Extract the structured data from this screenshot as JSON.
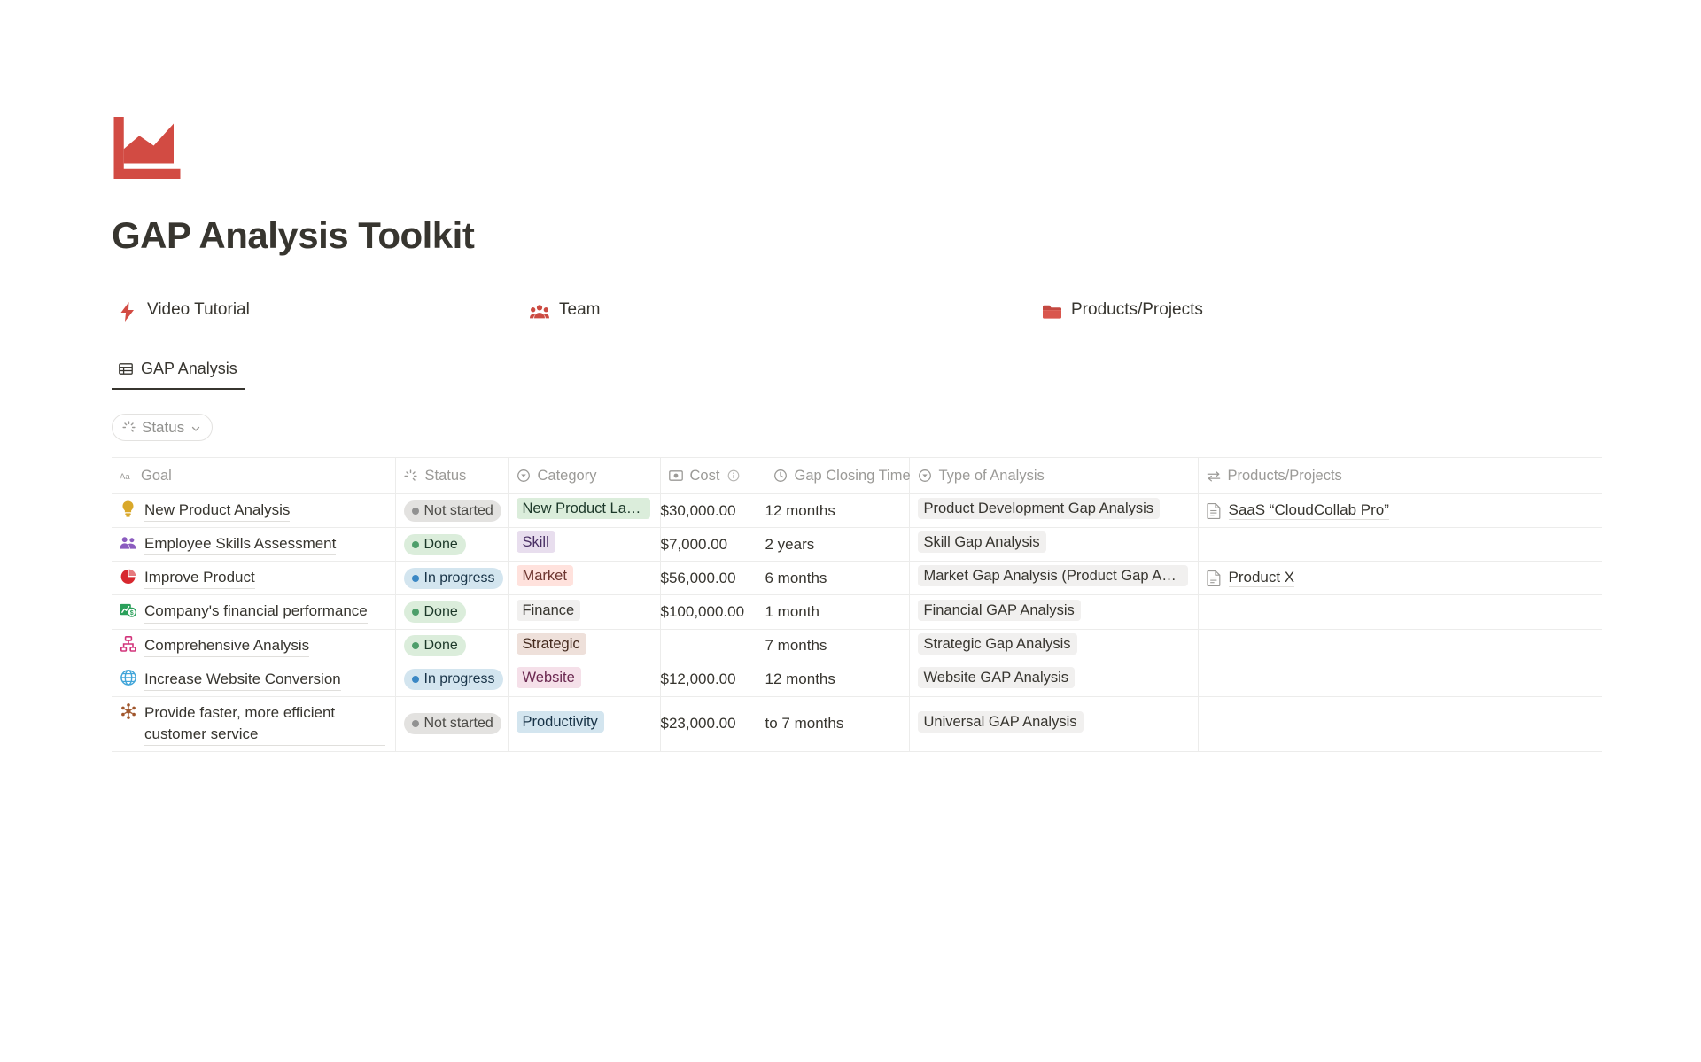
{
  "header": {
    "logo_icon": "area-chart-icon",
    "logo_color": "#d24b43",
    "title": "GAP Analysis Toolkit"
  },
  "nav_links": [
    {
      "label": "Video Tutorial",
      "icon": "lightning-bolt-icon",
      "color": "#d24b43"
    },
    {
      "label": "Team",
      "icon": "people-group-icon",
      "color": "#cc4b42"
    },
    {
      "label": "Products/Projects",
      "icon": "folder-icon",
      "color": "#d24b43"
    }
  ],
  "tabs": [
    {
      "label": "GAP Analysis",
      "icon": "table-grid-icon",
      "active": true
    }
  ],
  "filters": [
    {
      "label": "Status",
      "icon": "status-spinner-icon",
      "chevron": "chevron-down-icon"
    }
  ],
  "table": {
    "columns": [
      {
        "key": "goal",
        "label": "Goal",
        "icon": "title-aa-icon"
      },
      {
        "key": "status",
        "label": "Status",
        "icon": "status-spinner-icon"
      },
      {
        "key": "category",
        "label": "Category",
        "icon": "select-circle-icon"
      },
      {
        "key": "cost",
        "label": "Cost",
        "icon": "money-icon",
        "info_icon": "info-circle-icon"
      },
      {
        "key": "gap",
        "label": "Gap Closing Time",
        "icon": "clock-icon"
      },
      {
        "key": "type",
        "label": "Type of Analysis",
        "icon": "select-circle-icon"
      },
      {
        "key": "products",
        "label": "Products/Projects",
        "icon": "relation-arrows-icon"
      }
    ],
    "rows": [
      {
        "goal": "New Product Analysis",
        "goal_icon": "lightbulb-icon",
        "goal_icon_color": "#d9a82a",
        "status": "Not started",
        "status_bg": "#e3e2e0",
        "status_fg": "#4b4a46",
        "status_dot": "#919191",
        "category": "New Product Laun...",
        "category_bg": "#dbeddb",
        "category_fg": "#1c3829",
        "cost": "$30,000.00",
        "gap": "12 months",
        "type": "Product Development Gap Analysis",
        "product": "SaaS “CloudCollab Pro”",
        "product_icon": "document-icon"
      },
      {
        "goal": "Employee Skills Assessment",
        "goal_icon": "people-icon",
        "goal_icon_color": "#8b5cbf",
        "status": "Done",
        "status_bg": "#dbeddb",
        "status_fg": "#1c3829",
        "status_dot": "#4d9e6a",
        "category": "Skill",
        "category_bg": "#e8deee",
        "category_fg": "#492f64",
        "cost": "$7,000.00",
        "gap": "2 years",
        "type": "Skill Gap Analysis",
        "product": "",
        "product_icon": ""
      },
      {
        "goal": "Improve Product",
        "goal_icon": "pie-chart-icon",
        "goal_icon_color": "#d7282f",
        "status": "In progress",
        "status_bg": "#d3e5ef",
        "status_fg": "#183347",
        "status_dot": "#3a87c4",
        "category": "Market",
        "category_bg": "#ffe2dd",
        "category_fg": "#6e3630",
        "cost": "$56,000.00",
        "gap": "6 months",
        "type": "Market Gap Analysis (Product Gap Analy...",
        "product": "Product X",
        "product_icon": "document-icon"
      },
      {
        "goal": "Company's financial performance",
        "goal_icon": "chart-money-icon",
        "goal_icon_color": "#2aa05a",
        "status": "Done",
        "status_bg": "#dbeddb",
        "status_fg": "#1c3829",
        "status_dot": "#4d9e6a",
        "category": "Finance",
        "category_bg": "#f1f0ef",
        "category_fg": "#37352f",
        "cost": "$100,000.00",
        "gap": "1 month",
        "type": "Financial GAP Analysis",
        "product": "",
        "product_icon": ""
      },
      {
        "goal": "Comprehensive Analysis",
        "goal_icon": "hierarchy-icon",
        "goal_icon_color": "#d2337a",
        "status": "Done",
        "status_bg": "#dbeddb",
        "status_fg": "#1c3829",
        "status_dot": "#4d9e6a",
        "category": "Strategic",
        "category_bg": "#eee0da",
        "category_fg": "#442a1e",
        "cost": "",
        "gap": "7 months",
        "type": "Strategic Gap Analysis",
        "product": "",
        "product_icon": ""
      },
      {
        "goal": "Increase Website Conversion",
        "goal_icon": "globe-icon",
        "goal_icon_color": "#41a5d9",
        "status": "In progress",
        "status_bg": "#d3e5ef",
        "status_fg": "#183347",
        "status_dot": "#3a87c4",
        "category": "Website",
        "category_bg": "#f5e0e9",
        "category_fg": "#6b2850",
        "cost": "$12,000.00",
        "gap": "12 months",
        "type": "Website GAP Analysis",
        "product": "",
        "product_icon": ""
      },
      {
        "goal": "Provide faster, more efficient customer service",
        "goal_icon": "atom-gear-icon",
        "goal_icon_color": "#a0562c",
        "status": "Not started",
        "status_bg": "#e3e2e0",
        "status_fg": "#4b4a46",
        "status_dot": "#919191",
        "category": "Productivity",
        "category_bg": "#d3e5ef",
        "category_fg": "#183347",
        "cost": "$23,000.00",
        "gap": "to 7 months",
        "type": "Universal GAP Analysis",
        "product": "",
        "product_icon": ""
      }
    ]
  }
}
